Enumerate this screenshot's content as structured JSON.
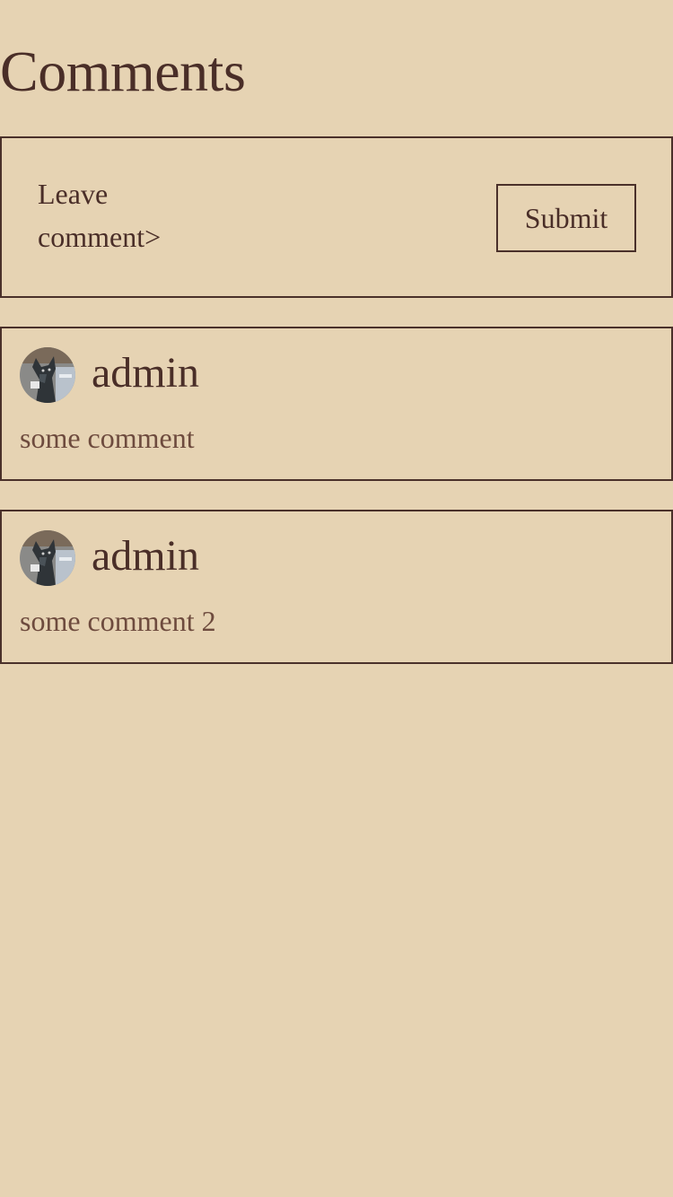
{
  "page": {
    "title": "Comments"
  },
  "form": {
    "input_label": "Leave comment>",
    "submit_label": "Submit"
  },
  "comments": [
    {
      "author": "admin",
      "text": "some comment",
      "avatar_icon": "dog-avatar"
    },
    {
      "author": "admin",
      "text": "some comment 2",
      "avatar_icon": "dog-avatar"
    }
  ],
  "colors": {
    "background": "#e6d3b3",
    "text": "#4a2e28",
    "comment_text": "#6e4b3e",
    "border": "#4a302a"
  }
}
